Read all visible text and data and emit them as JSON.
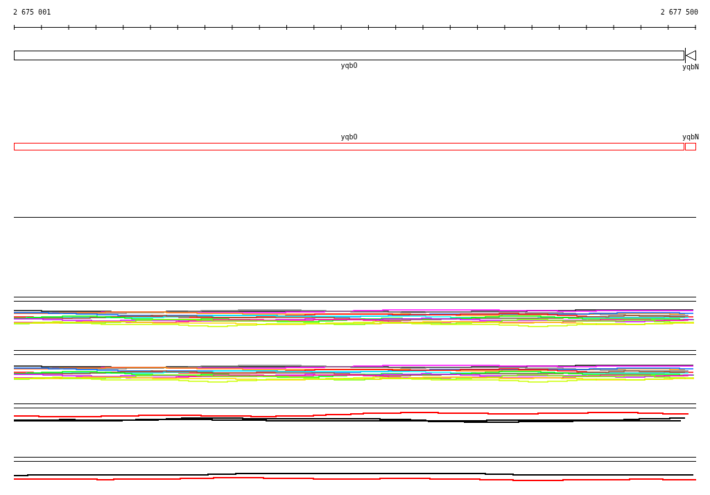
{
  "ruler": {
    "start_label": "2 675 001",
    "end_label": "2 677 500"
  },
  "gene_tracks": [
    {
      "labels_above": false,
      "color": "#000000",
      "genes": [
        {
          "label": "yqbO",
          "kind": "box"
        },
        {
          "label": "yqbN",
          "kind": "arrow"
        }
      ]
    },
    {
      "labels_above": true,
      "color": "#ff0000",
      "genes": [
        {
          "label": "yqbO",
          "kind": "box"
        },
        {
          "label": "yqbN",
          "kind": "box"
        }
      ]
    }
  ],
  "signal_tracks": [
    {
      "kind": "rainbow"
    },
    {
      "kind": "rainbow"
    },
    {
      "kind": "redfirst"
    },
    {
      "kind": "blackfirst"
    }
  ]
}
